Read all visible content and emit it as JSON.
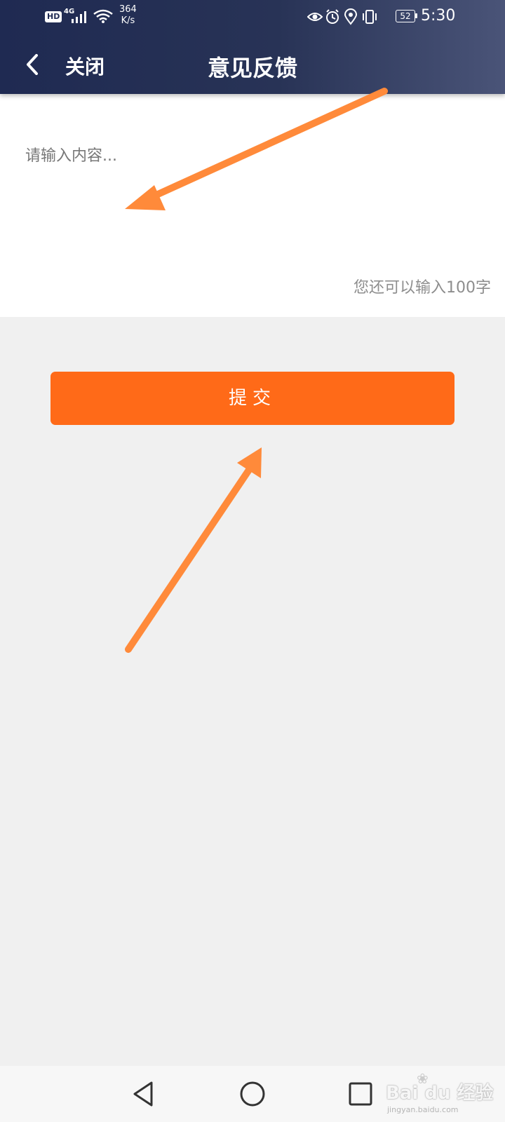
{
  "status_bar": {
    "hd": "HD",
    "network": "4G",
    "speed_value": "364",
    "speed_unit": "K/s",
    "battery": "52",
    "time": "5:30",
    "icons": [
      "signal-icon",
      "wifi-icon",
      "eye-icon",
      "alarm-icon",
      "location-icon",
      "vibrate-icon",
      "battery-icon"
    ]
  },
  "header": {
    "close_label": "关闭",
    "title": "意见反馈"
  },
  "feedback": {
    "placeholder": "请输入内容...",
    "value": "",
    "counter": "您还可以输入100字"
  },
  "submit": {
    "label": "提交"
  },
  "system_nav": {
    "icons": [
      "back-triangle-icon",
      "home-circle-icon",
      "recents-square-icon"
    ]
  },
  "watermark": {
    "logo": "Bai du 经验",
    "site": "jingyan.baidu.com"
  },
  "colors": {
    "header_bg": "#283356",
    "accent": "#ff6a18",
    "annotation_arrow": "#ff8a3a",
    "page_bg": "#f0f0f0"
  }
}
